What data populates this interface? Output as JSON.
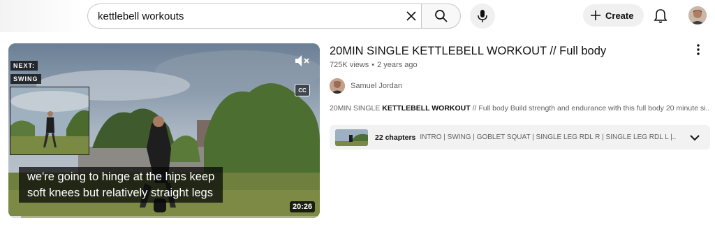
{
  "search": {
    "query": "kettlebell workouts"
  },
  "header": {
    "create_label": "Create"
  },
  "icons": {
    "clear": "close-icon",
    "search": "search-icon",
    "mic": "microphone-icon",
    "create": "plus-icon",
    "bell": "bell-icon",
    "mute": "volume-muted-icon",
    "cc": "closed-captions-icon",
    "more": "more-vertical-icon",
    "expand": "chevron-down-icon"
  },
  "player": {
    "next_label": "NEXT:",
    "next_title": "SWING",
    "cc_label": "CC",
    "caption_lines": [
      "we're going to hinge at the hips keep",
      "soft knees but relatively straight legs"
    ],
    "duration": "20:26",
    "progress": 0.04
  },
  "video": {
    "title": "20MIN SINGLE KETTLEBELL WORKOUT // Full body",
    "views": "725K views",
    "age": "2 years ago",
    "channel": "Samuel Jordan",
    "description_parts": {
      "pre": "20MIN SINGLE ",
      "bold": "KETTLEBELL WORKOUT",
      "post": " // Full body Build strength and endurance with this full body 20 minute si..."
    },
    "chapters_count": "22 chapters",
    "chapters_list": "INTRO | SWING | GOBLET SQUAT | SINGLE LEG RDL R | SINGLE LEG RDL L |..."
  },
  "colors": {
    "accent_text": "#0f0f0f",
    "secondary_text": "#606060",
    "chip_bg": "#f0f0f0"
  }
}
